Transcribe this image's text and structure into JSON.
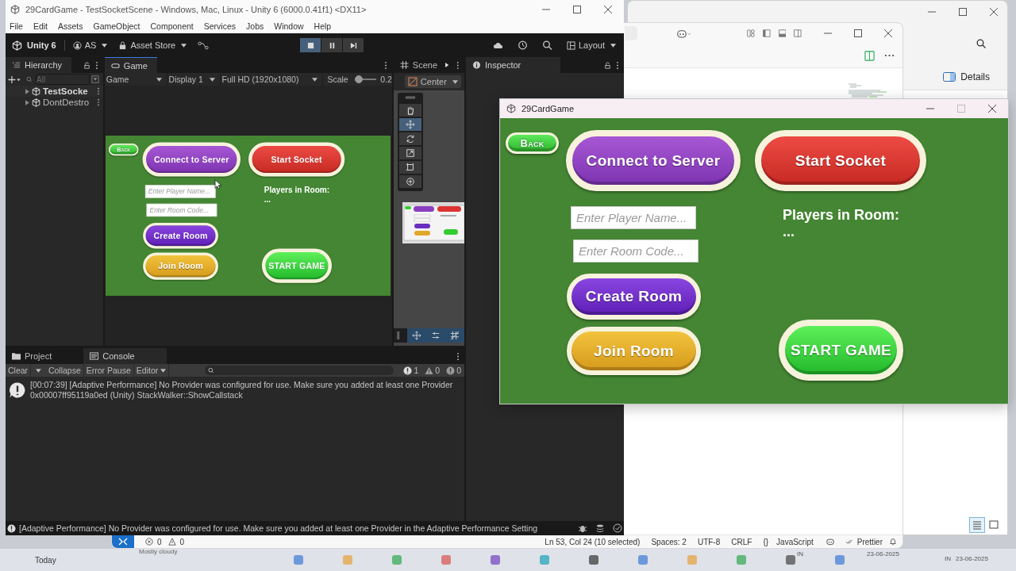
{
  "unity": {
    "title": "29CardGame - TestSocketScene - Windows, Mac, Linux - Unity 6 (6000.0.41f1) <DX11>",
    "menu": [
      "File",
      "Edit",
      "Assets",
      "GameObject",
      "Component",
      "Services",
      "Jobs",
      "Window",
      "Help"
    ],
    "toolbar": {
      "brand": "Unity 6",
      "account": "AS",
      "asset_store": "Asset Store",
      "layout": "Layout",
      "play_buttons": [
        {
          "kind": "stop",
          "selected": true
        },
        {
          "kind": "pause",
          "selected": false
        },
        {
          "kind": "step",
          "selected": false
        }
      ]
    },
    "hierarchy": {
      "tab": "Hierarchy",
      "search_placeholder": "All",
      "items": [
        {
          "label": "TestSocke",
          "active": true
        },
        {
          "label": "DontDestro",
          "active": false
        }
      ]
    },
    "game": {
      "tab": "Game",
      "mode": "Game",
      "display": "Display 1",
      "resolution": "Full HD (1920x1080)",
      "scale_label": "Scale",
      "scale_value": "0.2",
      "scale_slider": {
        "level": 0.1
      },
      "ui": {
        "back": "Back",
        "connect": "Connect to Server",
        "start_socket": "Start Socket",
        "player_name_placeholder": "Enter Player Name...",
        "room_code_placeholder": "Enter Room Code...",
        "players_label": "Players in Room:",
        "players_list": "...",
        "create_room": "Create Room",
        "join_room": "Join Room",
        "start_game": "START GAME"
      }
    },
    "scene": {
      "tab": "Scene",
      "pivot": "Center",
      "tools": [
        {
          "kind": "hand",
          "selected": false
        },
        {
          "kind": "move",
          "selected": true
        },
        {
          "kind": "rotate",
          "selected": false
        },
        {
          "kind": "scale",
          "selected": false
        },
        {
          "kind": "rect",
          "selected": false
        },
        {
          "kind": "transform",
          "selected": false
        }
      ]
    },
    "inspector": {
      "tab": "Inspector"
    },
    "bottom_tabs": [
      {
        "label": "Project",
        "selected": false
      },
      {
        "label": "Console",
        "selected": true
      }
    ],
    "console": {
      "clear": "Clear",
      "collapse": "Collapse",
      "error_pause": "Error Pause",
      "editor": "Editor",
      "counts": [
        {
          "kind": "info",
          "count": "1"
        },
        {
          "kind": "warning",
          "count": "0"
        },
        {
          "kind": "error",
          "count": "0"
        }
      ],
      "log_lines": [
        "[00:07:39] [Adaptive Performance] No Provider was configured for use. Make sure you added at least one Provider",
        "0x00007ff95119a0ed (Unity) StackWalker::ShowCallstack"
      ]
    },
    "status": "[Adaptive Performance] No Provider was configured for use. Make sure you added at least one Provider in the Adaptive Performance Setting"
  },
  "game_window": {
    "title": "29CardGame",
    "ui": {
      "back": "Back",
      "connect": "Connect to Server",
      "start_socket": "Start Socket",
      "player_name_placeholder": "Enter Player Name...",
      "room_code_placeholder": "Enter Room Code...",
      "players_label": "Players in Room:",
      "players_list": "...",
      "create_room": "Create Room",
      "join_room": "Join Room",
      "start_game": "START GAME"
    }
  },
  "vscode": {
    "status": {
      "errors": "0",
      "warnings": "0",
      "position": "Ln 53, Col 24 (10 selected)",
      "spaces": "Spaces: 2",
      "encoding": "UTF-8",
      "eol": "CRLF",
      "language_icon": "{}",
      "language": "JavaScript",
      "formatter": "Prettier"
    }
  },
  "explorer": {
    "details": "Details"
  },
  "taskbar": {
    "weather_day": "Today",
    "weather": "Mostly cloudy",
    "trays": [
      {
        "lang": "IN",
        "date": "23-06-2025"
      },
      {
        "lang": "IN",
        "date": "23-06-2025"
      }
    ]
  }
}
